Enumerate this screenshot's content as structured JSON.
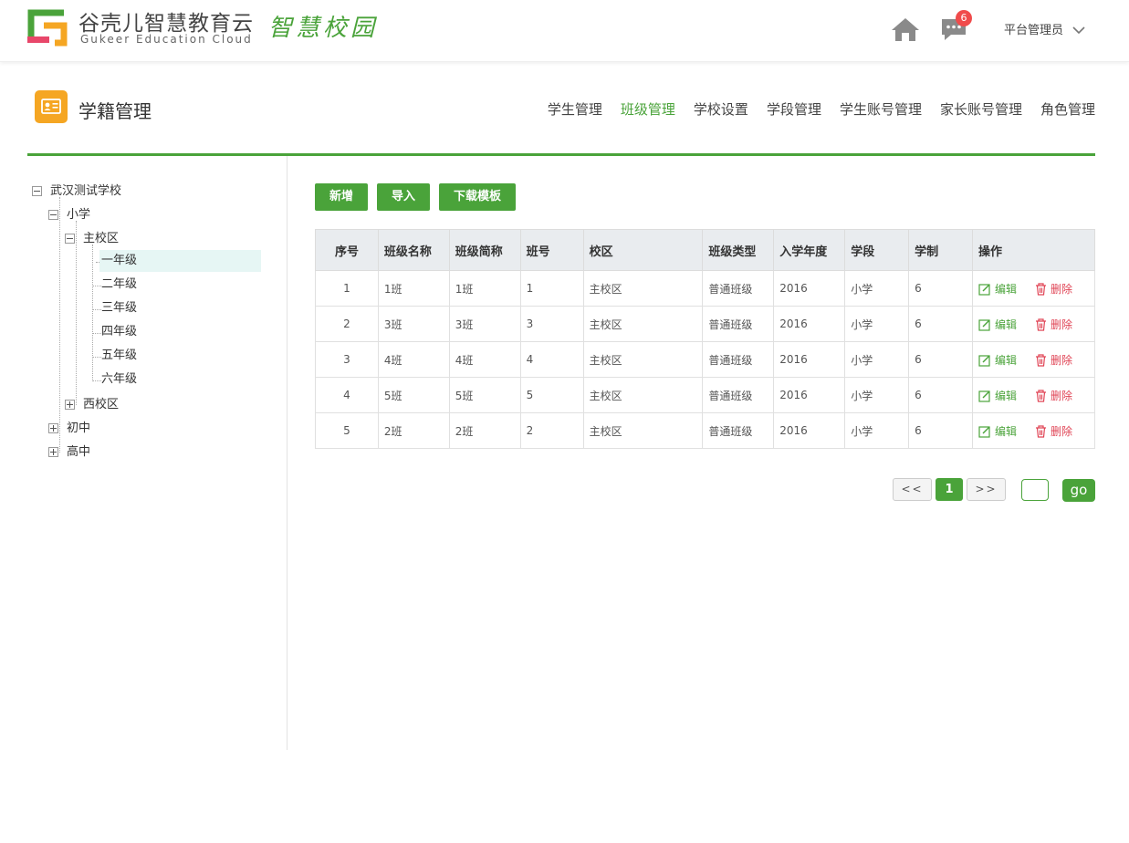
{
  "header": {
    "brand_cn": "谷壳儿智慧教育云",
    "brand_en": "Gukeer Education Cloud",
    "brand_tag": "智慧校园",
    "message_count": "6",
    "user": "平台管理员"
  },
  "module": {
    "title": "学籍管理",
    "nav": [
      "学生管理",
      "班级管理",
      "学校设置",
      "学段管理",
      "学生账号管理",
      "家长账号管理",
      "角色管理"
    ],
    "active_nav": "班级管理"
  },
  "tree": {
    "root": "武汉测试学校",
    "stage_primary": "小学",
    "campus_main": "主校区",
    "grades": [
      "一年级",
      "二年级",
      "三年级",
      "四年级",
      "五年级",
      "六年级"
    ],
    "selected_grade": "一年级",
    "campus_west": "西校区",
    "stage_middle": "初中",
    "stage_high": "高中"
  },
  "toolbar": {
    "add": "新增",
    "import": "导入",
    "download_template": "下载模板"
  },
  "table": {
    "columns": [
      "序号",
      "班级名称",
      "班级简称",
      "班号",
      "校区",
      "班级类型",
      "入学年度",
      "学段",
      "学制",
      "操作"
    ],
    "rows": [
      [
        "1",
        "1班",
        "1班",
        "1",
        "主校区",
        "普通班级",
        "2016",
        "小学",
        "6"
      ],
      [
        "2",
        "3班",
        "3班",
        "3",
        "主校区",
        "普通班级",
        "2016",
        "小学",
        "6"
      ],
      [
        "3",
        "4班",
        "4班",
        "4",
        "主校区",
        "普通班级",
        "2016",
        "小学",
        "6"
      ],
      [
        "4",
        "5班",
        "5班",
        "5",
        "主校区",
        "普通班级",
        "2016",
        "小学",
        "6"
      ],
      [
        "5",
        "2班",
        "2班",
        "2",
        "主校区",
        "普通班级",
        "2016",
        "小学",
        "6"
      ]
    ],
    "edit_label": "编辑",
    "delete_label": "删除"
  },
  "pagination": {
    "prev": "<<",
    "current": "1",
    "next": ">>",
    "go": "go"
  },
  "colors": {
    "accent": "#4aa33a",
    "danger": "#e04455",
    "module_icon": "#f5a623",
    "selected_bg": "#e6f6f4"
  }
}
